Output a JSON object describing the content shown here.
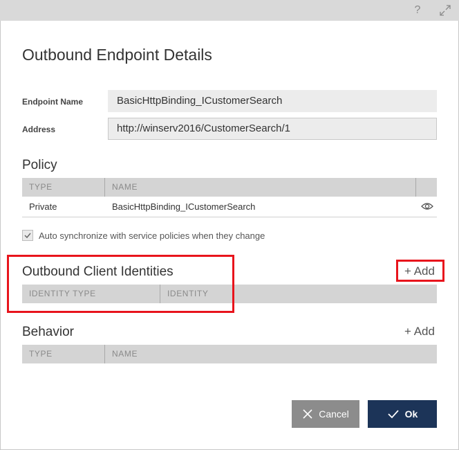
{
  "dialog": {
    "title": "Outbound Endpoint Details",
    "help_icon": "?",
    "expand_icon": "expand-icon"
  },
  "fields": {
    "endpoint_name_label": "Endpoint Name",
    "endpoint_name_value": "BasicHttpBinding_ICustomerSearch",
    "address_label": "Address",
    "address_value": "http://winserv2016/CustomerSearch/1"
  },
  "policy": {
    "title": "Policy",
    "columns": [
      "TYPE",
      "NAME"
    ],
    "rows": [
      {
        "type": "Private",
        "name": "BasicHttpBinding_ICustomerSearch",
        "action_icon": "eye-icon"
      }
    ],
    "auto_sync_label": "Auto synchronize with service policies when they change",
    "auto_sync_checked": true
  },
  "identities": {
    "title": "Outbound Client Identities",
    "add_label": "+ Add",
    "columns": [
      "IDENTITY TYPE",
      "IDENTITY"
    ]
  },
  "behavior": {
    "title": "Behavior",
    "add_label": "+ Add",
    "columns": [
      "TYPE",
      "NAME"
    ]
  },
  "buttons": {
    "cancel_label": "Cancel",
    "ok_label": "Ok"
  },
  "colors": {
    "cancel_bg": "#8c8c8c",
    "ok_bg": "#1c3458",
    "highlight": "#e8141c",
    "grid_header_bg": "#d4d4d4"
  }
}
